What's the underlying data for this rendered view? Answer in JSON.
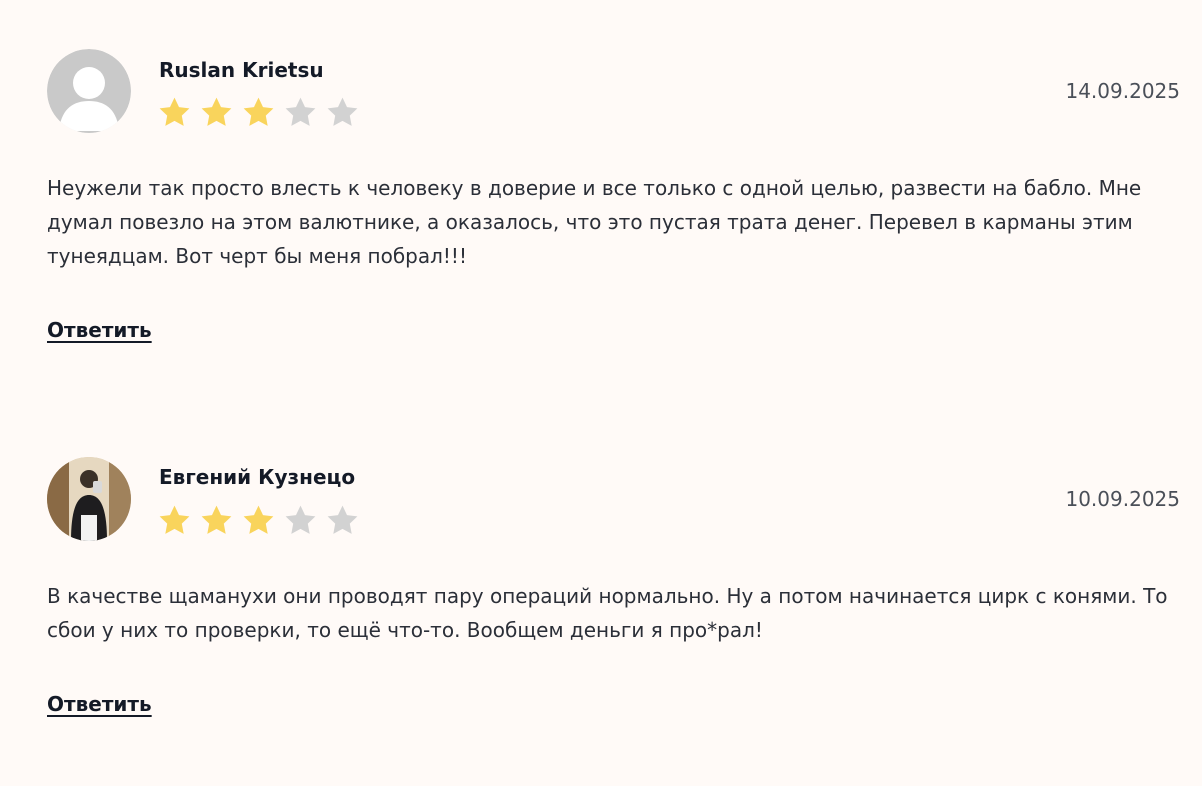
{
  "reviews": [
    {
      "author": "Ruslan Krietsu",
      "date": "14.09.2025",
      "rating": 3,
      "max_rating": 5,
      "avatar_icon": "default-user-avatar",
      "text": "Неужели так просто влесть к человеку в доверие и все только с одной целью, развести на бабло. Мне думал повезло на этом валютнике, а оказалось, что это пустая трата денег. Перевел в карманы этим тунеядцам. Вот черт бы меня побрал!!!",
      "reply_label": "Ответить"
    },
    {
      "author": "Евгений Кузнецо",
      "date": "10.09.2025",
      "rating": 3,
      "max_rating": 5,
      "avatar_icon": "user-photo-avatar",
      "text": "В качестве щаманухи они проводят пару операций нормально. Ну а потом начинается цирк с конями. То сбои у них то проверки, то ещё что-то. Вообщем деньги я про*рал!",
      "reply_label": "Ответить"
    }
  ],
  "colors": {
    "star_filled": "#f9d45c",
    "star_empty": "#d2d2d2",
    "background": "#fffaf7"
  }
}
